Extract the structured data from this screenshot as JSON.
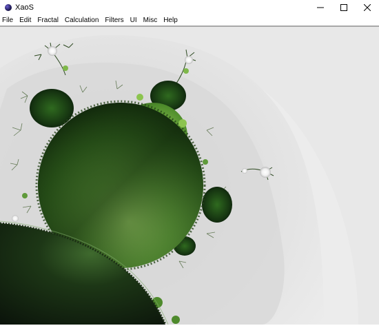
{
  "window": {
    "title": "XaoS",
    "icon": "xaos-app-icon",
    "controls": [
      "minimize-icon",
      "maximize-icon",
      "close-icon"
    ]
  },
  "menu": {
    "items": [
      "File",
      "Edit",
      "Fractal",
      "Calculation",
      "Filters",
      "UI",
      "Misc",
      "Help"
    ]
  },
  "colors": {
    "background": "#ececec",
    "outer_band": "#e6e6e6",
    "inner_band": "#d6d6d6",
    "set_dark": "#0c1d0a",
    "set_mid": "#2f5a1c",
    "set_light": "#8fc85a",
    "highlight": "#ffffff"
  }
}
